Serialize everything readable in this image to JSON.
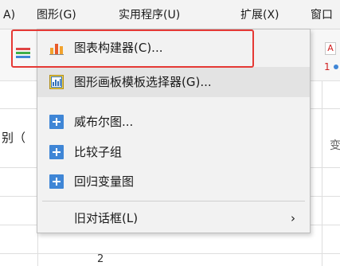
{
  "menubar": {
    "items": [
      {
        "label": "A)"
      },
      {
        "label": "图形(G)"
      },
      {
        "label": "实用程序(U)"
      },
      {
        "label": "扩展(X)"
      },
      {
        "label": "窗口"
      }
    ]
  },
  "dropdown": {
    "items": [
      {
        "label": "图表构建器(C)...",
        "icon": "chart-builder-icon",
        "highlighted": true
      },
      {
        "label": "图形画板模板选择器(G)...",
        "icon": "graphboard-template-icon",
        "hover": true
      },
      {
        "label": "威布尔图...",
        "icon": "plus-icon"
      },
      {
        "label": "比较子组",
        "icon": "plus-icon"
      },
      {
        "label": "回归变量图",
        "icon": "plus-icon"
      },
      {
        "label": "旧对话框(L)",
        "icon": "none",
        "submenu_arrow": "›"
      }
    ]
  },
  "background": {
    "left_text": "别（",
    "right_text": "变",
    "bottom_digit": "2",
    "right_top_icon": "A",
    "right_num_icon": "1"
  },
  "colors": {
    "highlight_border": "#e53935",
    "plus_icon": "#3f86d6",
    "menu_bg": "#f2f2f2",
    "hover_bg": "#e3e3e3"
  }
}
